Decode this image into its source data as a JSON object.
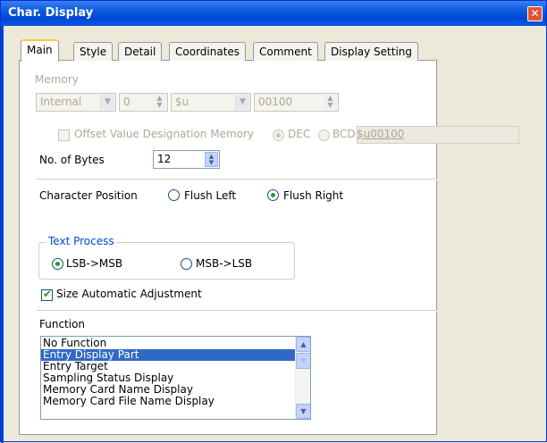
{
  "window": {
    "title": "Char. Display",
    "close_glyph": "✕"
  },
  "tabs": [
    {
      "label": "Main"
    },
    {
      "label": "Style"
    },
    {
      "label": "Detail"
    },
    {
      "label": "Coordinates"
    },
    {
      "label": "Comment"
    },
    {
      "label": "Display Setting"
    }
  ],
  "memory": {
    "label": "Memory",
    "device_value": "Internal",
    "number_value": "0",
    "type_value": "$u",
    "address_value": "00100"
  },
  "offset": {
    "label": "Offset Value Designation Memory",
    "dec_label": "DEC",
    "bcd_label": "BCD",
    "link_value": "$u00100"
  },
  "bytes": {
    "label": "No. of Bytes",
    "value": "12"
  },
  "char_position": {
    "label": "Character Position",
    "flush_left": "Flush Left",
    "flush_right": "Flush Right"
  },
  "text_process": {
    "title": "Text Process",
    "lsb_msb": "LSB->MSB",
    "msb_lsb": "MSB->LSB"
  },
  "size_auto": {
    "label": "Size Automatic Adjustment",
    "checked": true
  },
  "function": {
    "label": "Function",
    "items": [
      "No Function",
      "Entry Display Part",
      "Entry Target",
      "Sampling Status Display",
      "Memory Card Name Display",
      "Memory Card File Name Display"
    ],
    "selected_index": 1
  },
  "colors": {
    "accent": "#0046d5",
    "selection": "#316ac5",
    "check": "#21a121"
  }
}
